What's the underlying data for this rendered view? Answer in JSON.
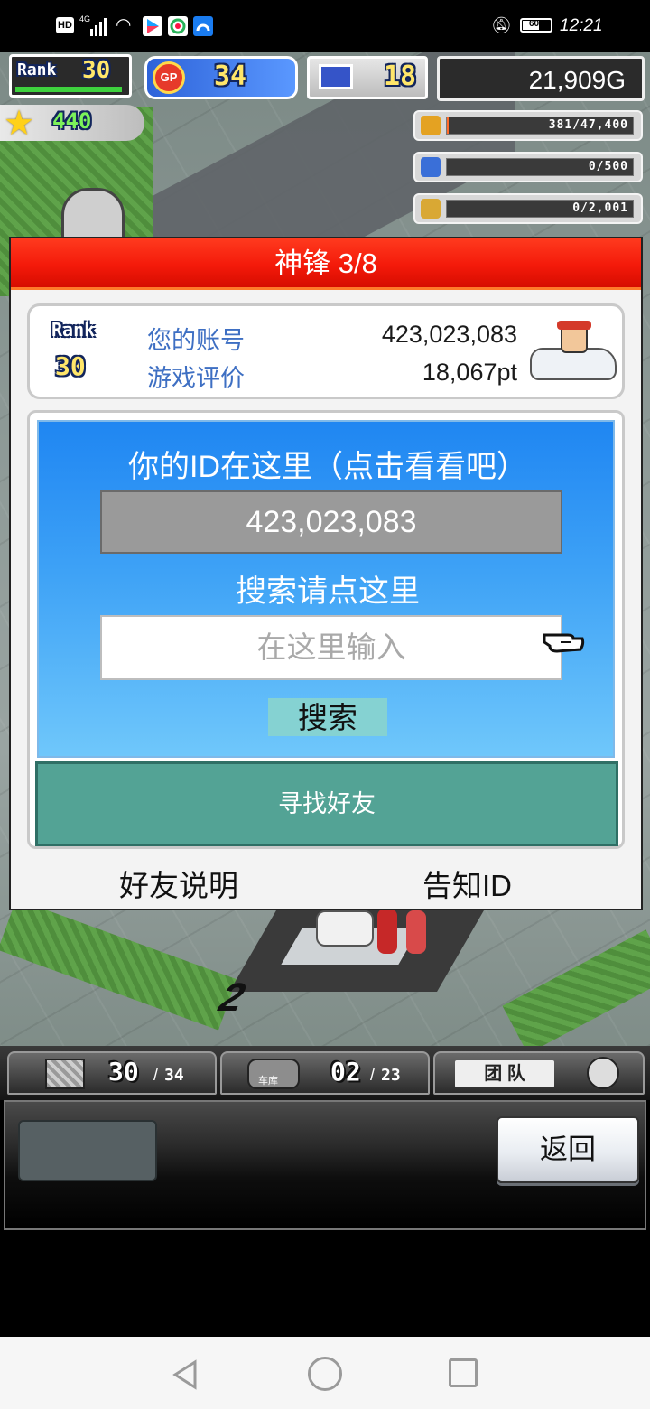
{
  "status_bar": {
    "left_text": "HD",
    "network": "4G",
    "time": "12:21",
    "battery": "60",
    "icons": [
      "hd-icon",
      "signal-icon",
      "wifi-icon",
      "app-icon-1",
      "app-icon-2",
      "app-icon-3",
      "mute-icon",
      "battery-icon"
    ]
  },
  "hud": {
    "rank_label": "Rank",
    "rank_value": "30",
    "gp_label": "GP",
    "gp_value": "34",
    "pc_value": "18",
    "gold": "21,909G",
    "stars": "440",
    "resources": [
      {
        "icon": "coin-stack-icon",
        "value": "381/47,400",
        "color": "#e4a222"
      },
      {
        "icon": "fuel-bottle-icon",
        "value": "0/500",
        "color": "#3a6fd8"
      },
      {
        "icon": "wheat-icon",
        "value": "0/2,001",
        "color": "#d9a834"
      }
    ]
  },
  "dialog": {
    "title": "神锋 3/8",
    "account": {
      "rank_label": "Rank",
      "rank_value": "30",
      "id_label": "您的账号",
      "id_value": "423,023,083",
      "rating_label": "游戏评价",
      "rating_value": "18,067pt"
    },
    "id_prompt": "你的ID在这里（点击看看吧）",
    "id_value": "423,023,083",
    "search_prompt": "搜索请点这里",
    "search_placeholder": "在这里输入",
    "search_button": "搜索",
    "find_friend_button": "寻找好友",
    "friend_help": "好友说明",
    "share_id": "告知ID"
  },
  "bottom": {
    "storage_current": "30",
    "storage_max": "34",
    "garage_label": "车库",
    "garage_current": "02",
    "garage_max": "23",
    "team_label": "团 队",
    "back_button": "返回"
  }
}
